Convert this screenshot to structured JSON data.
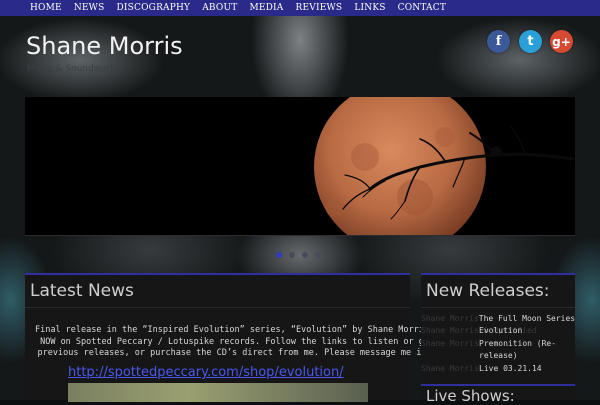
{
  "nav": {
    "items": [
      "HOME",
      "NEWS",
      "DISCOGRAPHY",
      "ABOUT",
      "MEDIA",
      "REVIEWS",
      "LINKS",
      "CONTACT"
    ]
  },
  "site": {
    "title": "Shane Morris",
    "tagline": "Music & Soundworks"
  },
  "social": {
    "facebook": "f",
    "twitter": "t",
    "google": "g+"
  },
  "slider": {
    "dots": 4,
    "active": 0
  },
  "news": {
    "title": "Latest News",
    "lines": [
      "Final release in the “Inspired Evolution” series, “Evolution” by Shane Morris",
      "NOW on Spotted Peccary / Lotuspike records. Follow the links to listen or g",
      "previous releases, or purchase the CD’s direct from me. Please message me if"
    ],
    "link": "http://spottedpeccary.com/shop/evolution/"
  },
  "releases": {
    "title": "New Releases:",
    "rows": [
      {
        "artist": "Shane Morris",
        "title": "The Full Moon Series"
      },
      {
        "artist": "Shane Morris & Mystified",
        "title": "Evolution"
      },
      {
        "artist": "Shane Morris",
        "title": "Premonition (Re-"
      },
      {
        "artist": "",
        "title": "release)"
      },
      {
        "artist": "Shane Morris",
        "title": "Live 03.21.14"
      }
    ]
  },
  "shows": {
    "title": "Live Shows:"
  },
  "colors": {
    "nav_bg": "#2a2a8a",
    "accent": "#2f2fa0",
    "link": "#4a58f0",
    "moon": "#c0704a"
  }
}
